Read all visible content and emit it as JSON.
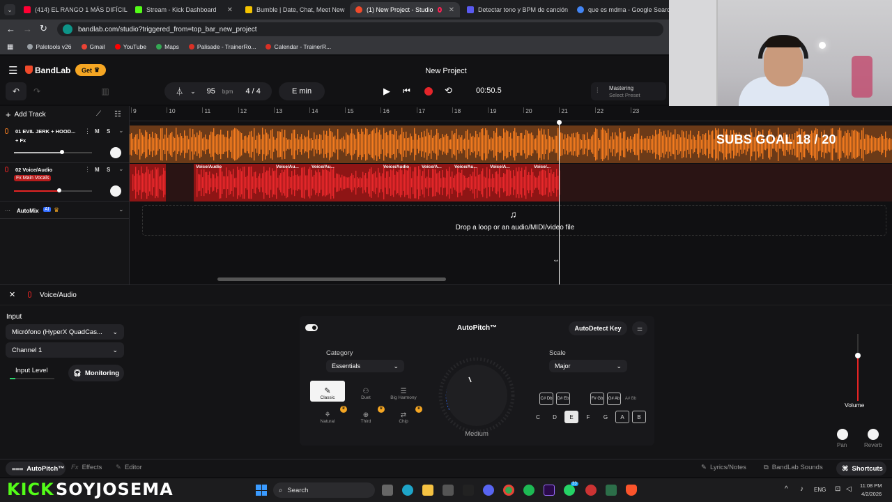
{
  "browser": {
    "tabs": [
      {
        "label": "(414) EL RANGO 1 MÁS DIFÍCIL",
        "color": "#ff0033"
      },
      {
        "label": "Stream - Kick Dashboard",
        "color": "#53fc18"
      },
      {
        "label": "Bumble | Date, Chat, Meet New",
        "color": "#f5c400"
      },
      {
        "label": "(1) New Project - Studio",
        "color": "#f04a2b",
        "active": true
      },
      {
        "label": "Detectar tono y BPM de canción",
        "color": "#5a5af0"
      },
      {
        "label": "que es mdma - Google Search",
        "color": "#4285f4"
      }
    ],
    "url": "bandlab.com/studio?triggered_from=top_bar_new_project",
    "bookmarks": [
      {
        "label": "Paletools v26",
        "color": "#9aa0a6"
      },
      {
        "label": "Gmail",
        "color": "#ea4335"
      },
      {
        "label": "YouTube",
        "color": "#ff0000"
      },
      {
        "label": "Maps",
        "color": "#34a853"
      },
      {
        "label": "Palisade - TrainerRo...",
        "color": "#d93025"
      },
      {
        "label": "Calendar - TrainerR...",
        "color": "#d93025"
      }
    ]
  },
  "header": {
    "brand": "BandLab",
    "get_label": "Get",
    "project_title": "New Project",
    "bpm": "95",
    "bpm_unit": "bpm",
    "time_signature": "4 / 4",
    "key": "E min",
    "time": "00:50.5",
    "mastering_label": "Mastering",
    "mastering_preset": "Select Preset"
  },
  "tracks": {
    "add_track": "Add Track",
    "ruler": [
      "9",
      "10",
      "11",
      "12",
      "13",
      "14",
      "15",
      "16",
      "17",
      "18",
      "19",
      "20",
      "21",
      "22",
      "23"
    ],
    "items": [
      {
        "name": "01  EVIL JERK + HOOD...",
        "fx": "+ Fx",
        "color": "#f07a20",
        "volume": 0.62
      },
      {
        "name": "02  Voice/Audio",
        "fx": "Fx Main Vocals",
        "color": "#e52424",
        "volume": 0.58
      }
    ],
    "region_labels": [
      "Voice/Audio",
      "Voice/Au...",
      "Voice/Au...",
      "Voice/Audio",
      "Voice/A...",
      "Voice/Au...",
      "Voice/A...",
      "Voice/..."
    ],
    "automix": "AutoMix",
    "ai_badge": "AI",
    "drop_text": "Drop a loop or an audio/MIDI/video file"
  },
  "overlay": {
    "subs_goal": "SUBS GOAL 18 / 20"
  },
  "panel": {
    "track_name": "Voice/Audio",
    "input_label": "Input",
    "input_device": "Micrófono (HyperX QuadCas...",
    "channel": "Channel 1",
    "input_level": "Input Level",
    "monitoring": "Monitoring",
    "plugin_title": "AutoPitch™",
    "autodetect": "AutoDetect Key",
    "category_label": "Category",
    "category_value": "Essentials",
    "effects": [
      "Classic",
      "Duet",
      "Big Harmony",
      "Natural",
      "Third",
      "Chip"
    ],
    "knob_label": "Medium",
    "scale_label": "Scale",
    "scale_value": "Major",
    "sharps": [
      "C# Db",
      "D# Eb",
      "F# Gb",
      "G# Ab",
      "A# Bb"
    ],
    "notes": [
      "C",
      "D",
      "E",
      "F",
      "G",
      "A",
      "B"
    ],
    "volume_label": "Volume",
    "pan_label": "Pan",
    "reverb_label": "Reverb"
  },
  "bottom_tabs": {
    "autopitch": "AutoPitch™",
    "effects": "Effects",
    "editor": "Editor",
    "lyrics": "Lyrics/Notes",
    "sounds": "BandLab Sounds",
    "shortcuts": "Shortcuts"
  },
  "stream": {
    "kick": "KICK",
    "channel": "SOYJOSEMA"
  },
  "taskbar": {
    "search": "Search",
    "lang": "ENG",
    "time": "11:08 PM",
    "date": "4/2/2026",
    "whatsapp_badge": "33"
  }
}
